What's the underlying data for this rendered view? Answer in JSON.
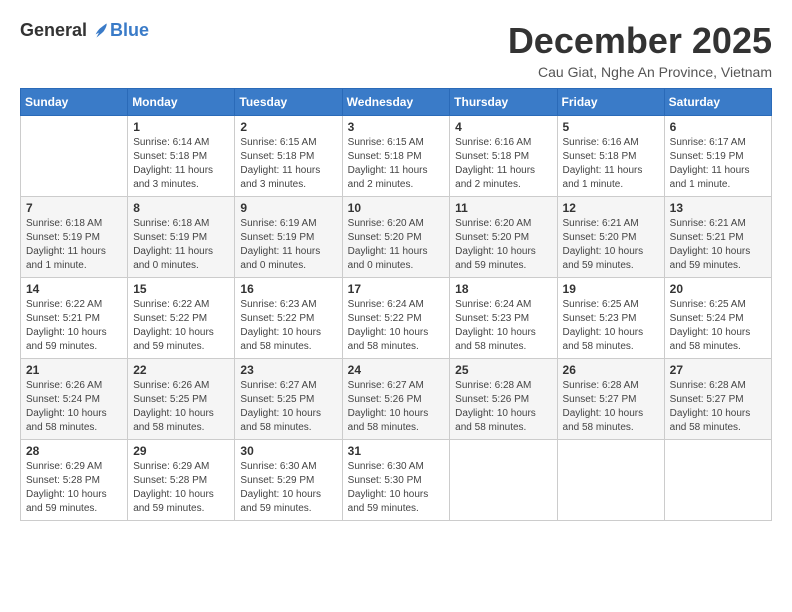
{
  "logo": {
    "general": "General",
    "blue": "Blue"
  },
  "header": {
    "month_title": "December 2025",
    "location": "Cau Giat, Nghe An Province, Vietnam"
  },
  "weekdays": [
    "Sunday",
    "Monday",
    "Tuesday",
    "Wednesday",
    "Thursday",
    "Friday",
    "Saturday"
  ],
  "weeks": [
    [
      {
        "day": "",
        "info": ""
      },
      {
        "day": "1",
        "info": "Sunrise: 6:14 AM\nSunset: 5:18 PM\nDaylight: 11 hours\nand 3 minutes."
      },
      {
        "day": "2",
        "info": "Sunrise: 6:15 AM\nSunset: 5:18 PM\nDaylight: 11 hours\nand 3 minutes."
      },
      {
        "day": "3",
        "info": "Sunrise: 6:15 AM\nSunset: 5:18 PM\nDaylight: 11 hours\nand 2 minutes."
      },
      {
        "day": "4",
        "info": "Sunrise: 6:16 AM\nSunset: 5:18 PM\nDaylight: 11 hours\nand 2 minutes."
      },
      {
        "day": "5",
        "info": "Sunrise: 6:16 AM\nSunset: 5:18 PM\nDaylight: 11 hours\nand 1 minute."
      },
      {
        "day": "6",
        "info": "Sunrise: 6:17 AM\nSunset: 5:19 PM\nDaylight: 11 hours\nand 1 minute."
      }
    ],
    [
      {
        "day": "7",
        "info": "Sunrise: 6:18 AM\nSunset: 5:19 PM\nDaylight: 11 hours\nand 1 minute."
      },
      {
        "day": "8",
        "info": "Sunrise: 6:18 AM\nSunset: 5:19 PM\nDaylight: 11 hours\nand 0 minutes."
      },
      {
        "day": "9",
        "info": "Sunrise: 6:19 AM\nSunset: 5:19 PM\nDaylight: 11 hours\nand 0 minutes."
      },
      {
        "day": "10",
        "info": "Sunrise: 6:20 AM\nSunset: 5:20 PM\nDaylight: 11 hours\nand 0 minutes."
      },
      {
        "day": "11",
        "info": "Sunrise: 6:20 AM\nSunset: 5:20 PM\nDaylight: 10 hours\nand 59 minutes."
      },
      {
        "day": "12",
        "info": "Sunrise: 6:21 AM\nSunset: 5:20 PM\nDaylight: 10 hours\nand 59 minutes."
      },
      {
        "day": "13",
        "info": "Sunrise: 6:21 AM\nSunset: 5:21 PM\nDaylight: 10 hours\nand 59 minutes."
      }
    ],
    [
      {
        "day": "14",
        "info": "Sunrise: 6:22 AM\nSunset: 5:21 PM\nDaylight: 10 hours\nand 59 minutes."
      },
      {
        "day": "15",
        "info": "Sunrise: 6:22 AM\nSunset: 5:22 PM\nDaylight: 10 hours\nand 59 minutes."
      },
      {
        "day": "16",
        "info": "Sunrise: 6:23 AM\nSunset: 5:22 PM\nDaylight: 10 hours\nand 58 minutes."
      },
      {
        "day": "17",
        "info": "Sunrise: 6:24 AM\nSunset: 5:22 PM\nDaylight: 10 hours\nand 58 minutes."
      },
      {
        "day": "18",
        "info": "Sunrise: 6:24 AM\nSunset: 5:23 PM\nDaylight: 10 hours\nand 58 minutes."
      },
      {
        "day": "19",
        "info": "Sunrise: 6:25 AM\nSunset: 5:23 PM\nDaylight: 10 hours\nand 58 minutes."
      },
      {
        "day": "20",
        "info": "Sunrise: 6:25 AM\nSunset: 5:24 PM\nDaylight: 10 hours\nand 58 minutes."
      }
    ],
    [
      {
        "day": "21",
        "info": "Sunrise: 6:26 AM\nSunset: 5:24 PM\nDaylight: 10 hours\nand 58 minutes."
      },
      {
        "day": "22",
        "info": "Sunrise: 6:26 AM\nSunset: 5:25 PM\nDaylight: 10 hours\nand 58 minutes."
      },
      {
        "day": "23",
        "info": "Sunrise: 6:27 AM\nSunset: 5:25 PM\nDaylight: 10 hours\nand 58 minutes."
      },
      {
        "day": "24",
        "info": "Sunrise: 6:27 AM\nSunset: 5:26 PM\nDaylight: 10 hours\nand 58 minutes."
      },
      {
        "day": "25",
        "info": "Sunrise: 6:28 AM\nSunset: 5:26 PM\nDaylight: 10 hours\nand 58 minutes."
      },
      {
        "day": "26",
        "info": "Sunrise: 6:28 AM\nSunset: 5:27 PM\nDaylight: 10 hours\nand 58 minutes."
      },
      {
        "day": "27",
        "info": "Sunrise: 6:28 AM\nSunset: 5:27 PM\nDaylight: 10 hours\nand 58 minutes."
      }
    ],
    [
      {
        "day": "28",
        "info": "Sunrise: 6:29 AM\nSunset: 5:28 PM\nDaylight: 10 hours\nand 59 minutes."
      },
      {
        "day": "29",
        "info": "Sunrise: 6:29 AM\nSunset: 5:28 PM\nDaylight: 10 hours\nand 59 minutes."
      },
      {
        "day": "30",
        "info": "Sunrise: 6:30 AM\nSunset: 5:29 PM\nDaylight: 10 hours\nand 59 minutes."
      },
      {
        "day": "31",
        "info": "Sunrise: 6:30 AM\nSunset: 5:30 PM\nDaylight: 10 hours\nand 59 minutes."
      },
      {
        "day": "",
        "info": ""
      },
      {
        "day": "",
        "info": ""
      },
      {
        "day": "",
        "info": ""
      }
    ]
  ]
}
